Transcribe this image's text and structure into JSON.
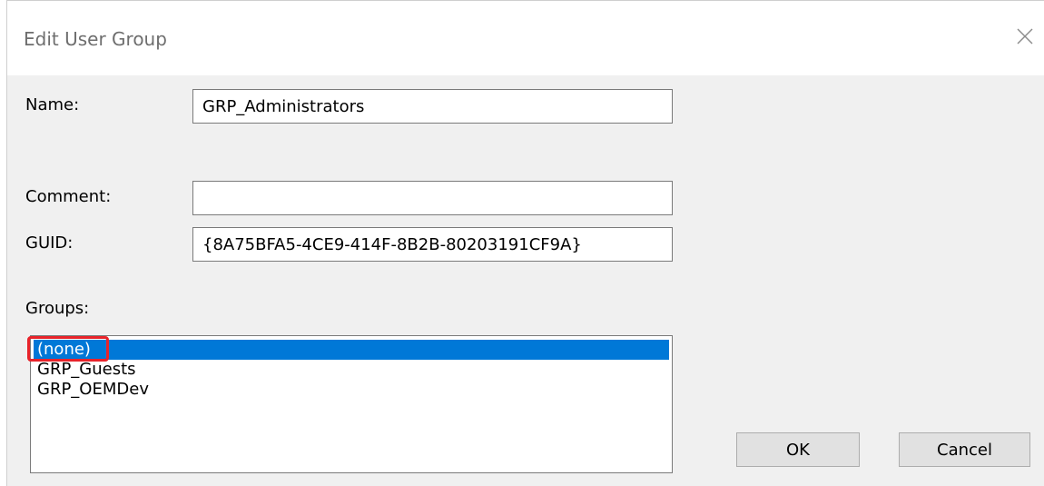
{
  "window": {
    "title": "Edit User Group",
    "close_icon": "close-icon"
  },
  "form": {
    "name_label": "Name:",
    "name_value": "GRP_Administrators",
    "comment_label": "Comment:",
    "comment_value": "",
    "guid_label": "GUID:",
    "guid_value": "{8A75BFA5-4CE9-414F-8B2B-80203191CF9A}",
    "groups_label": "Groups:"
  },
  "groups": {
    "items": [
      {
        "label": "(none)",
        "selected": true
      },
      {
        "label": "GRP_Guests",
        "selected": false
      },
      {
        "label": "GRP_OEMDev",
        "selected": false
      }
    ]
  },
  "buttons": {
    "ok_label": "OK",
    "cancel_label": "Cancel"
  },
  "colors": {
    "selection": "#0078d7",
    "annotation": "#e8232a"
  }
}
